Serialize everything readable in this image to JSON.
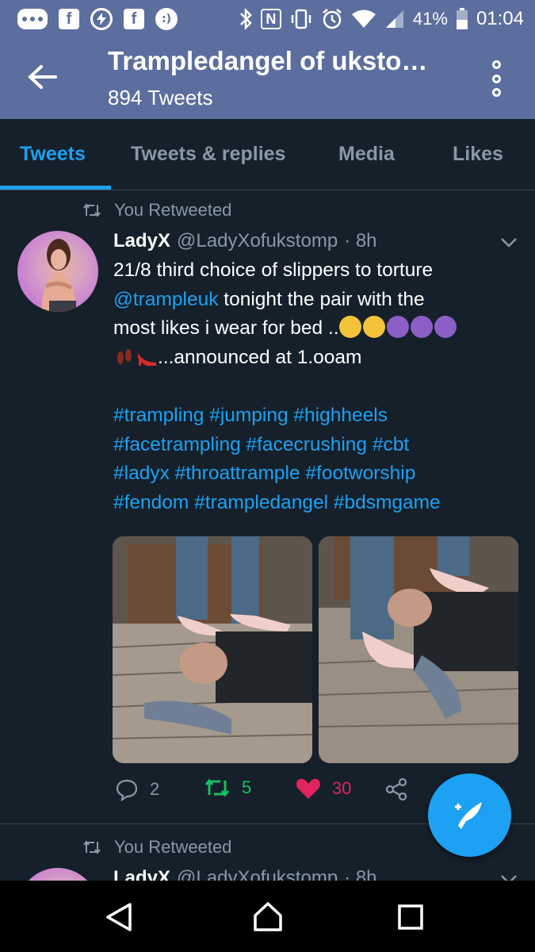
{
  "status_bar": {
    "battery": "41%",
    "time": "01:04",
    "icons": [
      "messages-icon",
      "facebook-icon",
      "flash-icon",
      "facebook-icon",
      "app-icon",
      "bluetooth-icon",
      "nfc-icon",
      "vibrate-icon",
      "alarm-icon",
      "wifi-icon",
      "signal-icon",
      "battery-icon"
    ]
  },
  "header": {
    "title": "Trampledangel of ukstо…",
    "subtitle": "894 Tweets"
  },
  "tabs": [
    {
      "label": "Tweets",
      "active": true
    },
    {
      "label": "Tweets & replies",
      "active": false
    },
    {
      "label": "Media",
      "active": false
    },
    {
      "label": "Likes",
      "active": false
    }
  ],
  "tweet1": {
    "retweet_label": "You Retweeted",
    "name": "LadyX",
    "handle": "@LadyXofukstomp",
    "time": "· 8h",
    "text_line1": "21/8 third choice of slippers to torture",
    "mention": "@trampleuk",
    "text_line2": " tonight the pair with the",
    "text_line3": "most likes i wear for bed ..",
    "text_line4": "...announced at 1.ooam",
    "hashtags_line1": "#trampling #jumping #highheels",
    "hashtags_line2": "#facetrampling #facecrushing #cbt",
    "hashtags_line3": "#ladyx #throattrample #footworship",
    "hashtags_line4": "#fendom #trampledangel #bdsmgame",
    "reply_count": "2",
    "retweet_count": "5",
    "like_count": "30"
  },
  "tweet2": {
    "retweet_label": "You Retweeted",
    "name": "LadyX",
    "handle": "@LadyXofukstomp",
    "time": "· 8h"
  },
  "colors": {
    "header_bg": "#5c6e9e",
    "background": "#15202b",
    "accent": "#1da1f2",
    "retweet_green": "#17bf63",
    "like_red": "#e0245e",
    "muted": "#8899a6"
  }
}
